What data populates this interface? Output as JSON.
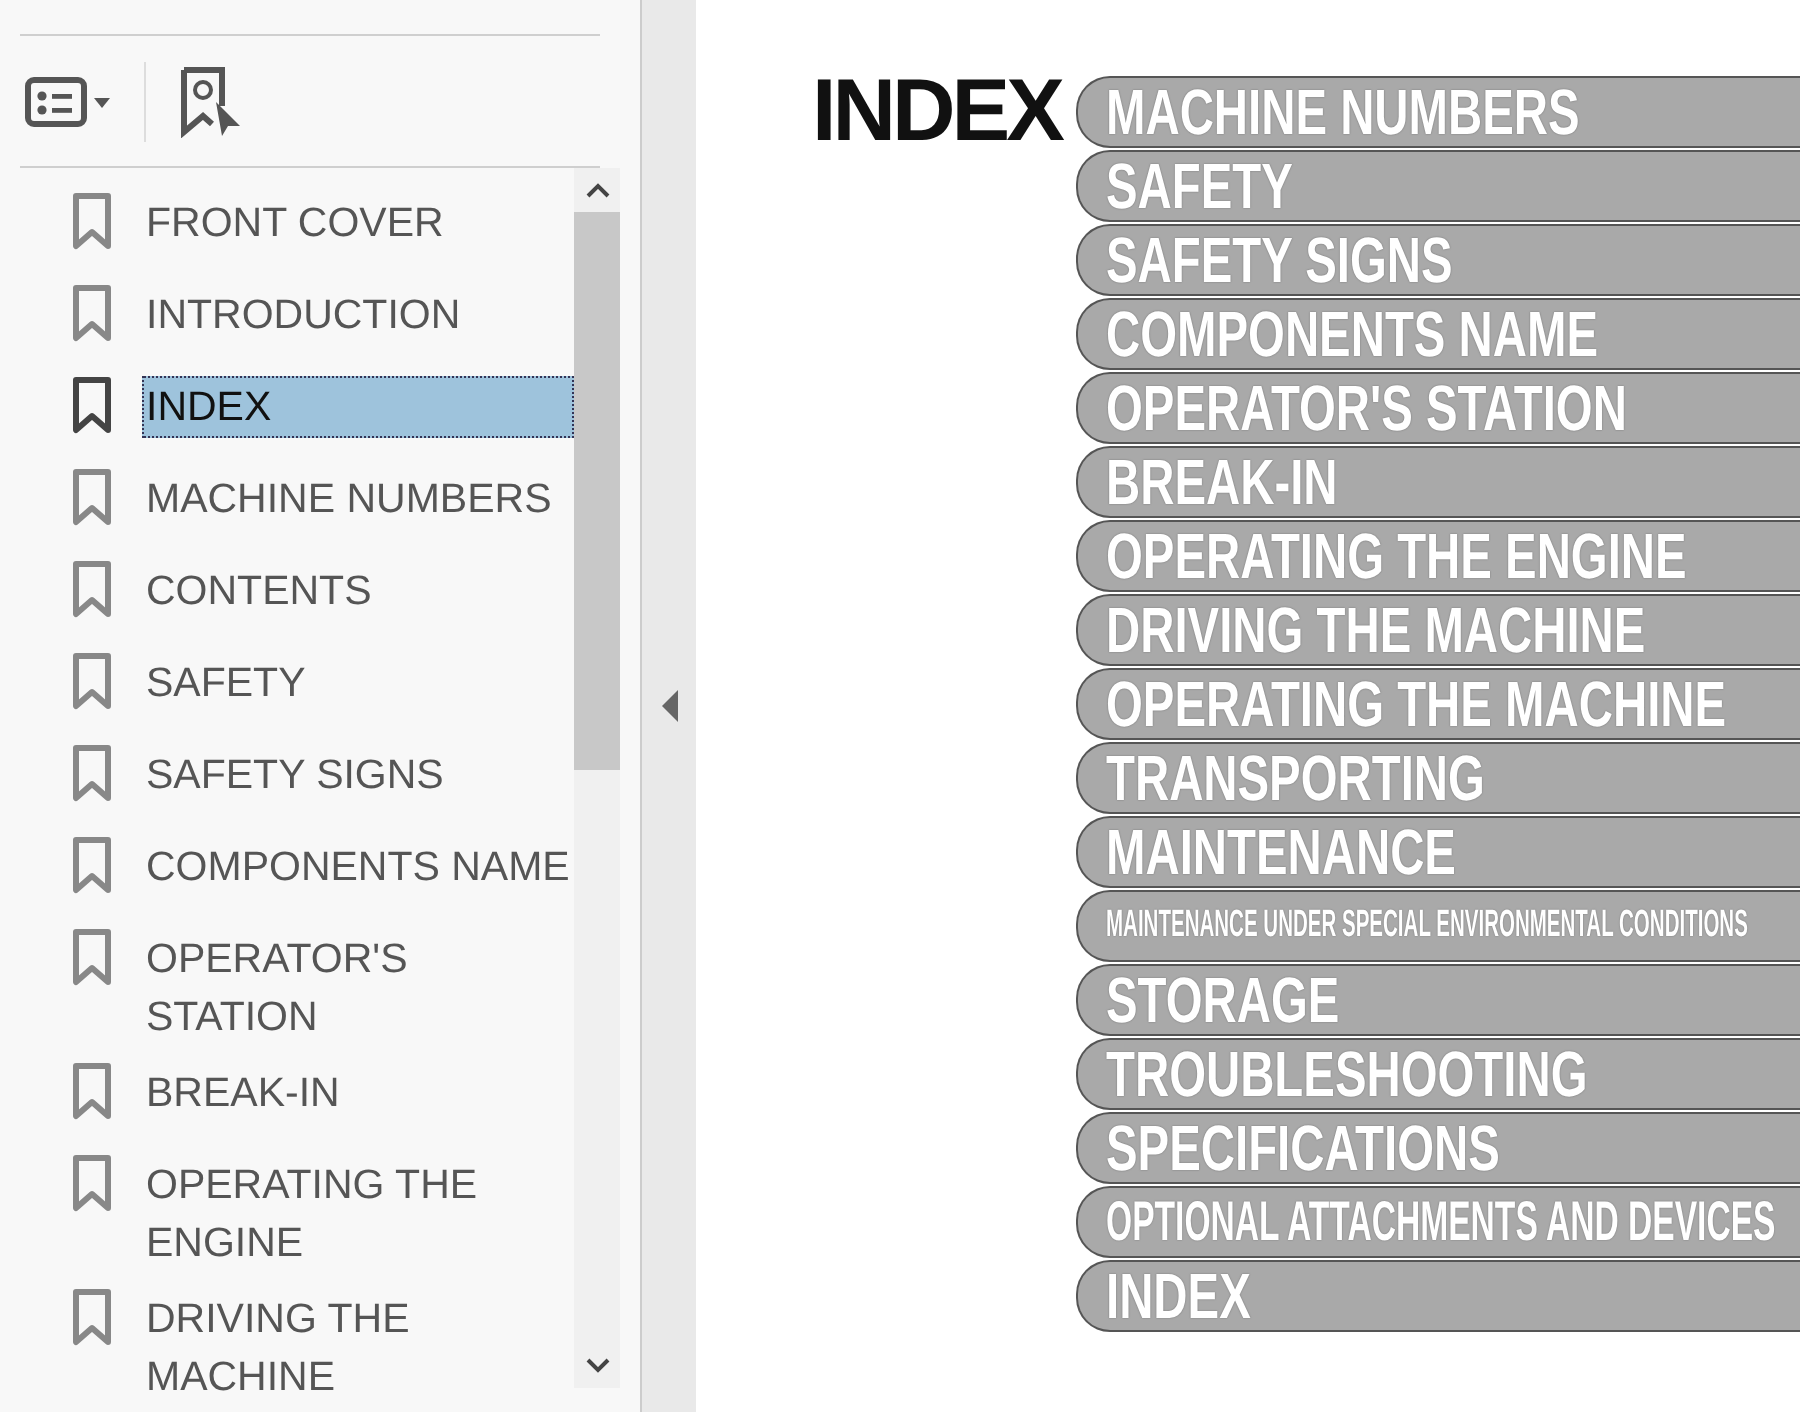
{
  "bookmarks": [
    {
      "label": "FRONT COVER",
      "selected": false
    },
    {
      "label": "INTRODUCTION",
      "selected": false
    },
    {
      "label": "INDEX",
      "selected": true
    },
    {
      "label": "MACHINE NUMBERS",
      "selected": false
    },
    {
      "label": "CONTENTS",
      "selected": false
    },
    {
      "label": "SAFETY",
      "selected": false
    },
    {
      "label": "SAFETY SIGNS",
      "selected": false
    },
    {
      "label": "COMPONENTS NAME",
      "selected": false
    },
    {
      "label": "OPERATOR'S STATION",
      "selected": false
    },
    {
      "label": "BREAK-IN",
      "selected": false
    },
    {
      "label": "OPERATING THE ENGINE",
      "selected": false
    },
    {
      "label": "DRIVING THE MACHINE",
      "selected": false
    }
  ],
  "page": {
    "heading": "INDEX",
    "tabs": [
      {
        "label": "MACHINE NUMBERS",
        "kind": "large"
      },
      {
        "label": "SAFETY",
        "kind": "large"
      },
      {
        "label": "SAFETY SIGNS",
        "kind": "large"
      },
      {
        "label": "COMPONENTS NAME",
        "kind": "large"
      },
      {
        "label": "OPERATOR'S STATION",
        "kind": "large"
      },
      {
        "label": "BREAK-IN",
        "kind": "large"
      },
      {
        "label": "OPERATING THE ENGINE",
        "kind": "large"
      },
      {
        "label": "DRIVING THE MACHINE",
        "kind": "large"
      },
      {
        "label": "OPERATING THE MACHINE",
        "kind": "large"
      },
      {
        "label": "TRANSPORTING",
        "kind": "large"
      },
      {
        "label": "MAINTENANCE",
        "kind": "large"
      },
      {
        "label": "MAINTENANCE UNDER SPECIAL ENVIRONMENTAL CONDITIONS",
        "kind": "small"
      },
      {
        "label": "STORAGE",
        "kind": "large"
      },
      {
        "label": "TROUBLESHOOTING",
        "kind": "large"
      },
      {
        "label": "SPECIFICATIONS",
        "kind": "large"
      },
      {
        "label": "OPTIONAL ATTACHMENTS AND DEVICES",
        "kind": "medium"
      },
      {
        "label": "INDEX",
        "kind": "large"
      }
    ]
  }
}
